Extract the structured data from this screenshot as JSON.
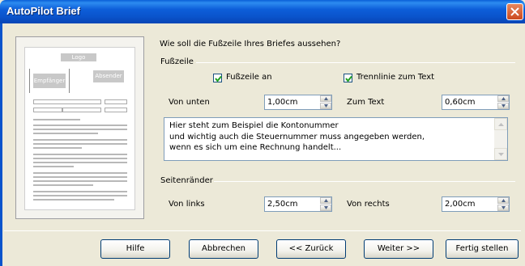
{
  "window": {
    "title": "AutoPilot Brief"
  },
  "preview": {
    "logo": "Logo",
    "recipient": "Empfänger",
    "sender": "Absender"
  },
  "question": "Wie soll die Fußzeile Ihres Briefes aussehen?",
  "footer_group": {
    "label": "Fußzeile",
    "include_footer": {
      "label": "Fußzeile an",
      "checked": true
    },
    "separator_line": {
      "label": "Trennlinie zum Text",
      "checked": true
    },
    "from_bottom": {
      "label": "Von unten",
      "value": "1,00cm"
    },
    "to_text": {
      "label": "Zum Text",
      "value": "0,60cm"
    },
    "text": "Hier steht zum Beispiel die Kontonummer\nund wichtig auch die Steuernummer muss angegeben werden,\nwenn es sich um eine Rechnung handelt..."
  },
  "margins_group": {
    "label": "Seitenränder",
    "left": {
      "label": "Von links",
      "value": "2,50cm"
    },
    "right": {
      "label": "Von rechts",
      "value": "2,00cm"
    }
  },
  "buttons": {
    "help": "Hilfe",
    "cancel": "Abbrechen",
    "back": "<< Zurück",
    "next": "Weiter >>",
    "finish": "Fertig stellen"
  },
  "colors": {
    "titlebar": "#0a54cc",
    "dialog_bg": "#ece9d8",
    "close": "#cc4a1e"
  }
}
